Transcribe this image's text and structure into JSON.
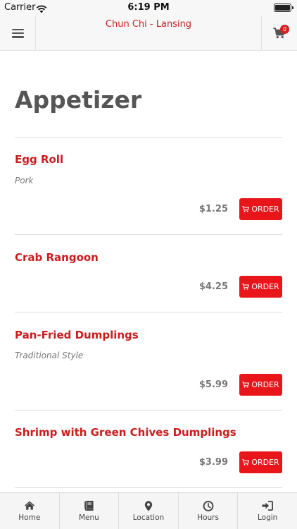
{
  "status_bar": {
    "carrier": "Carrier",
    "time": "6:19 PM"
  },
  "header": {
    "title": "Chun Chi - Lansing",
    "cart_count": "0"
  },
  "section": {
    "title": "Appetizer"
  },
  "items": [
    {
      "name": "Egg Roll",
      "description": "Pork",
      "price": "$1.25",
      "order_label": "ORDER"
    },
    {
      "name": "Crab Rangoon",
      "price": "$4.25",
      "order_label": "ORDER"
    },
    {
      "name": "Pan-Fried Dumplings",
      "description": "Traditional Style",
      "price": "$5.99",
      "order_label": "ORDER"
    },
    {
      "name": "Shrimp with Green Chives Dumplings",
      "price": "$3.99",
      "order_label": "ORDER"
    }
  ],
  "tabs": [
    {
      "label": "Home",
      "icon": "home-icon"
    },
    {
      "label": "Menu",
      "icon": "book-icon"
    },
    {
      "label": "Location",
      "icon": "map-pin-icon"
    },
    {
      "label": "Hours",
      "icon": "clock-icon"
    },
    {
      "label": "Login",
      "icon": "sign-in-icon"
    }
  ],
  "colors": {
    "accent": "#d31f1f",
    "order_button": "#e8161b",
    "text": "#555555"
  }
}
